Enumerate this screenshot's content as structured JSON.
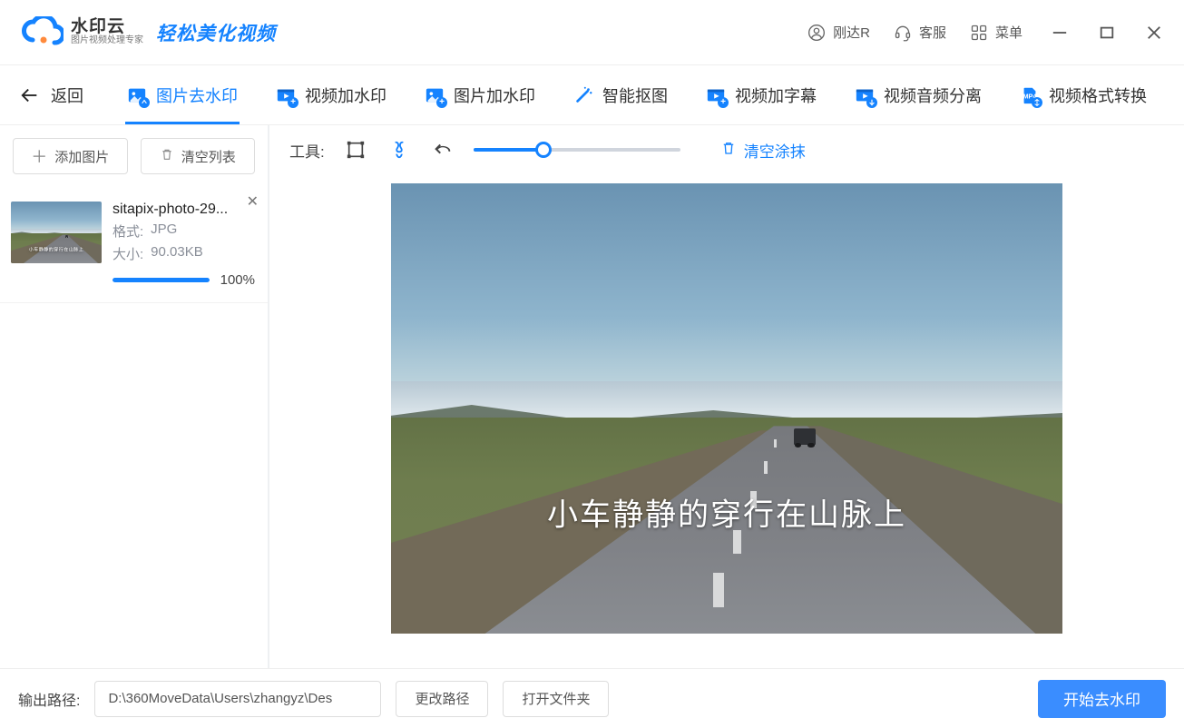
{
  "brand": {
    "name": "水印云",
    "sub": "图片视频处理专家",
    "slogan": "轻松美化视频"
  },
  "titlebar": {
    "user": "刚达R",
    "support": "客服",
    "menu": "菜单"
  },
  "nav": {
    "back": "返回",
    "tabs": [
      {
        "label": "图片去水印",
        "icon": "image",
        "badge": "eraser",
        "active": true
      },
      {
        "label": "视频加水印",
        "icon": "video",
        "badge": "plus"
      },
      {
        "label": "图片加水印",
        "icon": "image",
        "badge": "plus"
      },
      {
        "label": "智能抠图",
        "icon": "wand",
        "badge": ""
      },
      {
        "label": "视频加字幕",
        "icon": "video",
        "badge": "plus"
      },
      {
        "label": "视频音频分离",
        "icon": "video",
        "badge": "extract"
      },
      {
        "label": "视频格式转换",
        "icon": "file",
        "badge": "swap"
      }
    ]
  },
  "sidebar": {
    "add": "添加图片",
    "clear": "清空列表",
    "file": {
      "name": "sitapix-photo-29...",
      "format_label": "格式:",
      "format_value": "JPG",
      "size_label": "大小:",
      "size_value": "90.03KB",
      "progress_pct": 100,
      "progress_text": "100%"
    }
  },
  "toolbar": {
    "label": "工具:",
    "clear_paint": "清空涂抹",
    "brush_pct": 34
  },
  "image": {
    "overlay_text": "小车静静的穿行在山脉上"
  },
  "footer": {
    "label": "输出路径:",
    "path": "D:\\360MoveData\\Users\\zhangyz\\Des",
    "change": "更改路径",
    "open": "打开文件夹",
    "start": "开始去水印"
  }
}
